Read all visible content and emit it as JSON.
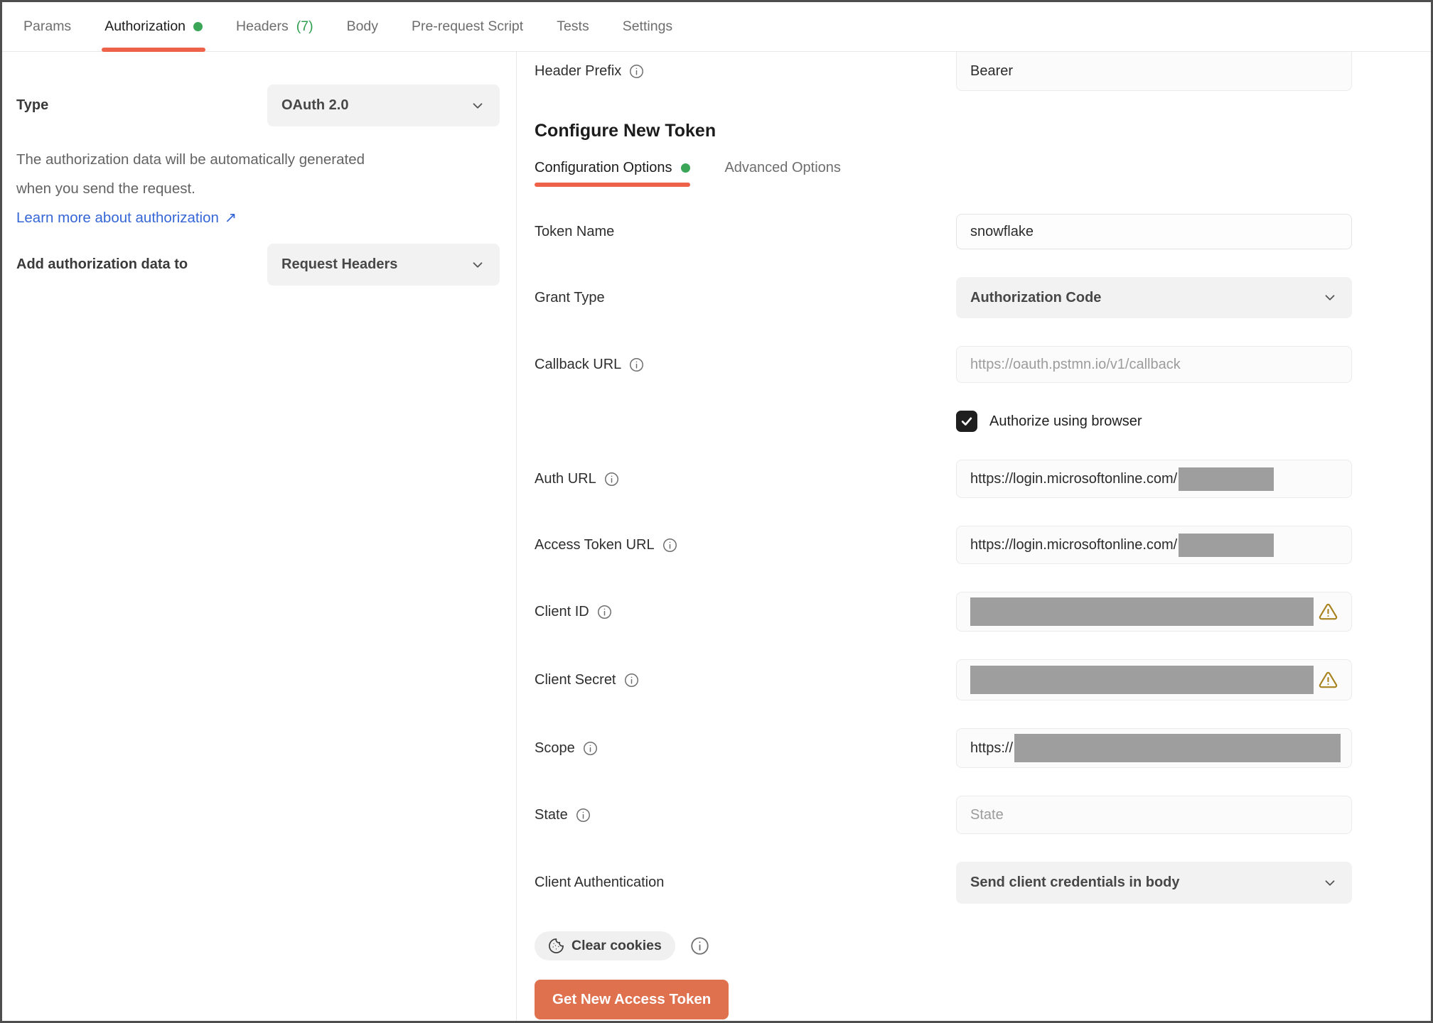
{
  "colors": {
    "accent_orange": "#ED6248",
    "button_orange": "#E0714E",
    "green_dot": "#3BA558",
    "headers_count_green": "#2E9E4F",
    "link_blue": "#3566D6",
    "redaction_gray": "#9E9E9E",
    "warning_amber": "#A8821E"
  },
  "tabs": {
    "params": "Params",
    "authorization": "Authorization",
    "headers": "Headers",
    "headers_count": "(7)",
    "body": "Body",
    "prerequest": "Pre-request Script",
    "tests": "Tests",
    "settings": "Settings",
    "active": "Authorization"
  },
  "left_panel": {
    "type_label": "Type",
    "type_value": "OAuth 2.0",
    "description_line1": "The authorization data will be automatically generated",
    "description_line2": "when you send the request.",
    "learn_more_label": "Learn more about authorization",
    "learn_more_arrow": "↗",
    "add_auth_label": "Add authorization data to",
    "add_auth_value": "Request Headers"
  },
  "right_panel": {
    "header_prefix": {
      "label": "Header Prefix",
      "value": "Bearer"
    },
    "section_title": "Configure New Token",
    "subtabs": {
      "configuration": "Configuration Options",
      "advanced": "Advanced Options",
      "active": "Configuration Options"
    },
    "token_name": {
      "label": "Token Name",
      "value": "snowflake"
    },
    "grant_type": {
      "label": "Grant Type",
      "value": "Authorization Code"
    },
    "callback_url": {
      "label": "Callback URL",
      "placeholder": "https://oauth.pstmn.io/v1/callback"
    },
    "authorize_browser": {
      "label": "Authorize using browser",
      "checked": true
    },
    "auth_url": {
      "label": "Auth URL",
      "value": "https://login.microsoftonline.com/",
      "redacted_suffix": true
    },
    "access_token_url": {
      "label": "Access Token URL",
      "value": "https://login.microsoftonline.com/",
      "redacted_suffix": true
    },
    "client_id": {
      "label": "Client ID",
      "redacted": true,
      "warning": true
    },
    "client_secret": {
      "label": "Client Secret",
      "redacted": true,
      "warning": true
    },
    "scope": {
      "label": "Scope",
      "value": "https://",
      "redacted_suffix": true
    },
    "state": {
      "label": "State",
      "placeholder": "State"
    },
    "client_authentication": {
      "label": "Client Authentication",
      "value": "Send client credentials in body"
    },
    "actions": {
      "clear_cookies": "Clear cookies",
      "get_new_access_token": "Get New Access Token"
    }
  }
}
